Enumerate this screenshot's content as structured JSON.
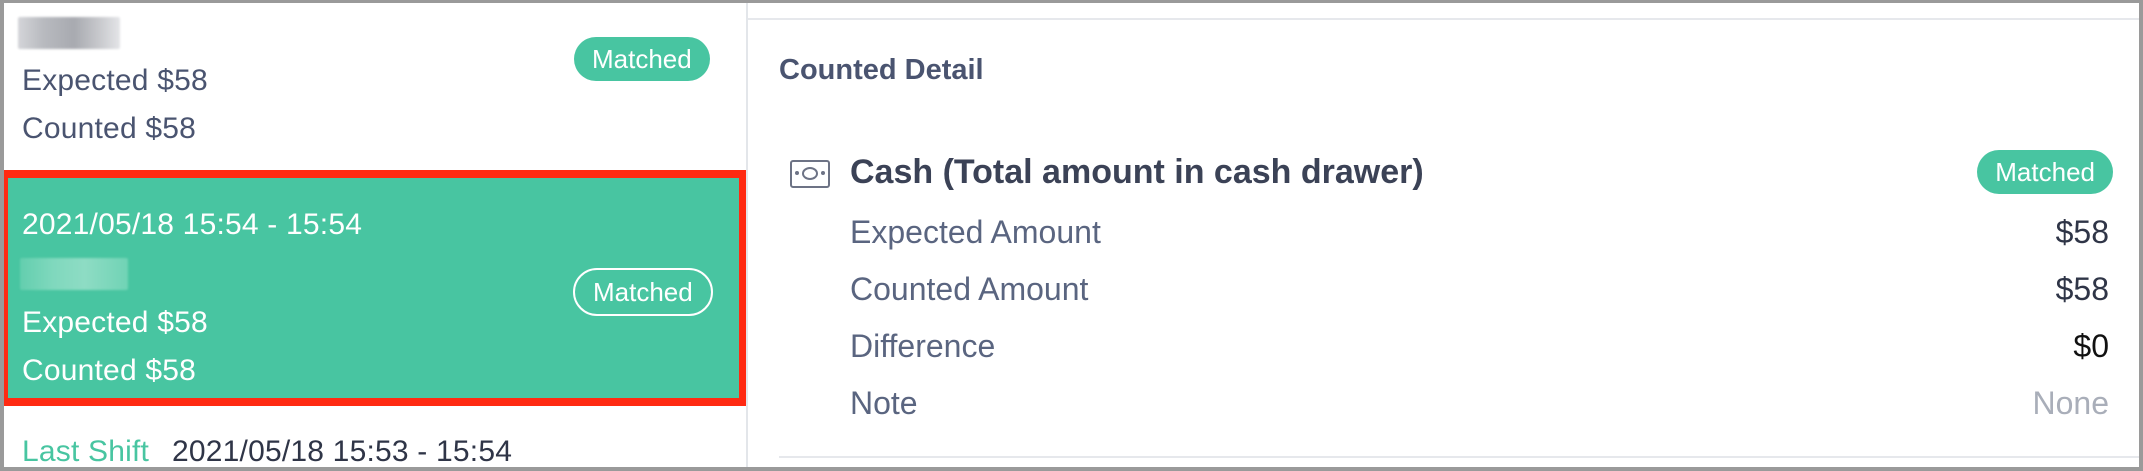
{
  "list": {
    "item_prev": {
      "expected": "Expected $58",
      "counted": "Counted $58",
      "badge": "Matched"
    },
    "item_selected": {
      "time_range": "2021/05/18 15:54 - 15:54",
      "expected": "Expected $58",
      "counted": "Counted $58",
      "badge": "Matched"
    },
    "last_shift": {
      "label": "Last Shift",
      "time_range": "2021/05/18 15:53 - 15:54"
    }
  },
  "detail": {
    "title": "Counted Detail",
    "cash": {
      "icon": "cash-icon",
      "title": "Cash (Total amount in cash drawer)",
      "badge": "Matched",
      "rows": [
        {
          "label": "Expected Amount",
          "value": "$58"
        },
        {
          "label": "Counted Amount",
          "value": "$58"
        },
        {
          "label": "Difference",
          "value": "$0"
        },
        {
          "label": "Note",
          "value": "None"
        }
      ]
    }
  },
  "colors": {
    "accent": "#48c5a1",
    "highlight_border": "#ff2a12",
    "text": "#4a5470"
  }
}
